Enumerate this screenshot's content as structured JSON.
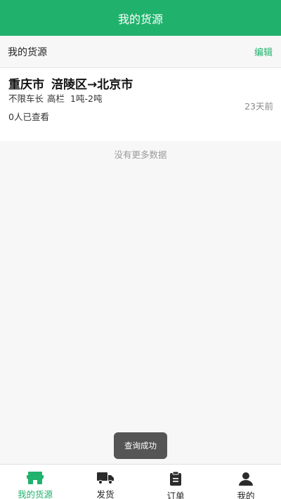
{
  "header": {
    "title": "我的货源"
  },
  "section": {
    "title": "我的货源",
    "edit_label": "编辑"
  },
  "listing": {
    "origin_city": "重庆市",
    "origin_district": "涪陵区",
    "arrow": "→",
    "destination": "北京市",
    "vehicle_length": "不限车长",
    "vehicle_type": "高栏",
    "weight": "1吨-2吨",
    "viewed": "0人已查看",
    "posted": "23天前"
  },
  "list_footer": "没有更多数据",
  "toast": "查询成功",
  "tabbar": {
    "tabs": [
      {
        "label": "我的货源",
        "icon": "storefront-icon",
        "active": true
      },
      {
        "label": "发货",
        "icon": "truck-icon",
        "active": false
      },
      {
        "label": "订单",
        "icon": "clipboard-icon",
        "active": false
      },
      {
        "label": "我的",
        "icon": "person-icon",
        "active": false
      }
    ]
  },
  "colors": {
    "brand": "#20b26c",
    "toast_bg": "#555555",
    "icon_dark": "#2b2b2b"
  }
}
